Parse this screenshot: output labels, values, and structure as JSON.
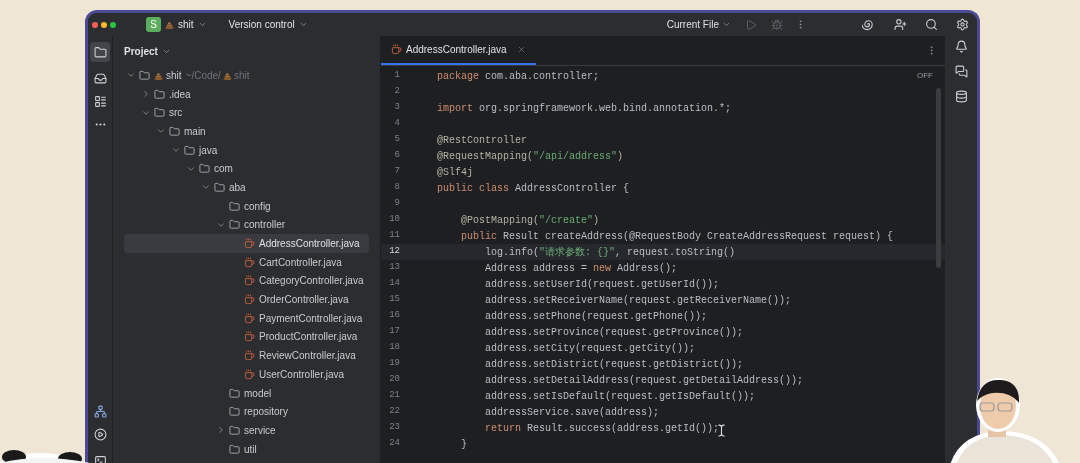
{
  "title_bar": {
    "project_badge": "S",
    "project": "shit",
    "vcs": "Version control",
    "run_config": "Current File"
  },
  "project_panel": {
    "title": "Project",
    "tree": [
      {
        "label": "shit",
        "kind": "project",
        "path": "~/Code/",
        "path_name": "shit",
        "expanded": true,
        "selected": false,
        "children": [
          {
            "label": ".idea",
            "kind": "folder",
            "expanded": false,
            "selected": false
          },
          {
            "label": "src",
            "kind": "folder",
            "expanded": true,
            "selected": false,
            "children": [
              {
                "label": "main",
                "kind": "folder",
                "expanded": true,
                "selected": false,
                "children": [
                  {
                    "label": "java",
                    "kind": "folder",
                    "expanded": true,
                    "selected": false,
                    "children": [
                      {
                        "label": "com",
                        "kind": "folder",
                        "expanded": true,
                        "selected": false,
                        "children": [
                          {
                            "label": "aba",
                            "kind": "folder",
                            "expanded": true,
                            "selected": false,
                            "children": [
                              {
                                "label": "config",
                                "kind": "empty-folder",
                                "selected": false
                              },
                              {
                                "label": "controller",
                                "kind": "folder",
                                "expanded": true,
                                "selected": false,
                                "children": [
                                  {
                                    "label": "AddressController.java",
                                    "kind": "java-file",
                                    "selected": true
                                  },
                                  {
                                    "label": "CartController.java",
                                    "kind": "java-file",
                                    "selected": false
                                  },
                                  {
                                    "label": "CategoryController.java",
                                    "kind": "java-file",
                                    "selected": false
                                  },
                                  {
                                    "label": "OrderController.java",
                                    "kind": "java-file",
                                    "selected": false
                                  },
                                  {
                                    "label": "PaymentController.java",
                                    "kind": "java-file",
                                    "selected": false
                                  },
                                  {
                                    "label": "ProductController.java",
                                    "kind": "java-file",
                                    "selected": false
                                  },
                                  {
                                    "label": "ReviewController.java",
                                    "kind": "java-file",
                                    "selected": false
                                  },
                                  {
                                    "label": "UserController.java",
                                    "kind": "java-file",
                                    "selected": false
                                  }
                                ]
                              },
                              {
                                "label": "model",
                                "kind": "empty-folder",
                                "selected": false
                              },
                              {
                                "label": "repository",
                                "kind": "empty-folder",
                                "selected": false
                              },
                              {
                                "label": "service",
                                "kind": "folder",
                                "expanded": false,
                                "selected": false
                              },
                              {
                                "label": "util",
                                "kind": "empty-folder",
                                "selected": false
                              }
                            ]
                          }
                        ]
                      }
                    ]
                  }
                ]
              }
            ]
          }
        ]
      }
    ]
  },
  "editor": {
    "tab": {
      "label": "AddressController.java",
      "selected": true
    },
    "inspection": "OFF",
    "lines": [
      {
        "number": "1",
        "selected": false,
        "tokens": [
          {
            "kind": "keyword",
            "text": "package"
          },
          {
            "kind": "plain",
            "text": " com.aba.controller;"
          }
        ]
      },
      {
        "number": "2",
        "selected": false
      },
      {
        "number": "3",
        "selected": false,
        "tokens": [
          {
            "kind": "keyword",
            "text": "import"
          },
          {
            "kind": "plain",
            "text": " org.springframework.web.bind.annotation.*;"
          }
        ]
      },
      {
        "number": "4",
        "selected": false
      },
      {
        "number": "5",
        "selected": false,
        "tokens": [
          {
            "kind": "annotation",
            "text": "@RestController"
          }
        ]
      },
      {
        "number": "6",
        "selected": false,
        "tokens": [
          {
            "kind": "annotation",
            "text": "@RequestMapping("
          },
          {
            "kind": "string",
            "text": "\"/api/address\""
          },
          {
            "kind": "annotation",
            "text": ")"
          }
        ]
      },
      {
        "number": "7",
        "selected": false,
        "tokens": [
          {
            "kind": "annotation",
            "text": "@Slf4j"
          }
        ]
      },
      {
        "number": "8",
        "selected": false,
        "tokens": [
          {
            "kind": "keyword",
            "text": "public class"
          },
          {
            "kind": "plain",
            "text": " AddressController {"
          }
        ]
      },
      {
        "number": "9",
        "selected": false
      },
      {
        "number": "10",
        "selected": false,
        "tokens": [
          {
            "kind": "annotation",
            "text": "    @PostMapping("
          },
          {
            "kind": "string",
            "text": "\"/create\""
          },
          {
            "kind": "annotation",
            "text": ")"
          }
        ]
      },
      {
        "number": "11",
        "selected": false,
        "tokens": [
          {
            "kind": "keyword",
            "text": "    public"
          },
          {
            "kind": "plain",
            "text": " Result createAddress(@RequestBody CreateAddressRequest request) {"
          }
        ]
      },
      {
        "number": "12",
        "selected": true,
        "tokens": [
          {
            "kind": "plain",
            "text": "        log.info("
          },
          {
            "kind": "string",
            "text": "\"请求参数: {}\""
          },
          {
            "kind": "plain",
            "text": ", request.toString()"
          }
        ]
      },
      {
        "number": "13",
        "selected": false,
        "tokens": [
          {
            "kind": "plain",
            "text": "        Address address = "
          },
          {
            "kind": "keyword",
            "text": "new"
          },
          {
            "kind": "plain",
            "text": " Address();"
          }
        ]
      },
      {
        "number": "14",
        "selected": false,
        "tokens": [
          {
            "kind": "plain",
            "text": "        address.setUserId(request.getUserId());"
          }
        ]
      },
      {
        "number": "15",
        "selected": false,
        "tokens": [
          {
            "kind": "plain",
            "text": "        address.setReceiverName(request.getReceiverName());"
          }
        ]
      },
      {
        "number": "16",
        "selected": false,
        "tokens": [
          {
            "kind": "plain",
            "text": "        address.setPhone(request.getPhone());"
          }
        ]
      },
      {
        "number": "17",
        "selected": false,
        "tokens": [
          {
            "kind": "plain",
            "text": "        address.setProvince(request.getProvince());"
          }
        ]
      },
      {
        "number": "18",
        "selected": false,
        "tokens": [
          {
            "kind": "plain",
            "text": "        address.setCity(request.getCity());"
          }
        ]
      },
      {
        "number": "19",
        "selected": false,
        "tokens": [
          {
            "kind": "plain",
            "text": "        address.setDistrict(request.getDistrict());"
          }
        ]
      },
      {
        "number": "20",
        "selected": false,
        "tokens": [
          {
            "kind": "plain",
            "text": "        address.setDetailAddress(request.getDetailAddress());"
          }
        ]
      },
      {
        "number": "21",
        "selected": false,
        "tokens": [
          {
            "kind": "plain",
            "text": "        address.setIsDefault(request.getIsDefault());"
          }
        ]
      },
      {
        "number": "22",
        "selected": false,
        "tokens": [
          {
            "kind": "plain",
            "text": "        addressService.save(address);"
          }
        ]
      },
      {
        "number": "23",
        "selected": false,
        "tokens": [
          {
            "kind": "keyword",
            "text": "        return"
          },
          {
            "kind": "plain",
            "text": " Result.success(address.getId());"
          }
        ]
      },
      {
        "number": "24",
        "selected": false,
        "tokens": [
          {
            "kind": "plain",
            "text": "    }"
          }
        ]
      }
    ]
  }
}
